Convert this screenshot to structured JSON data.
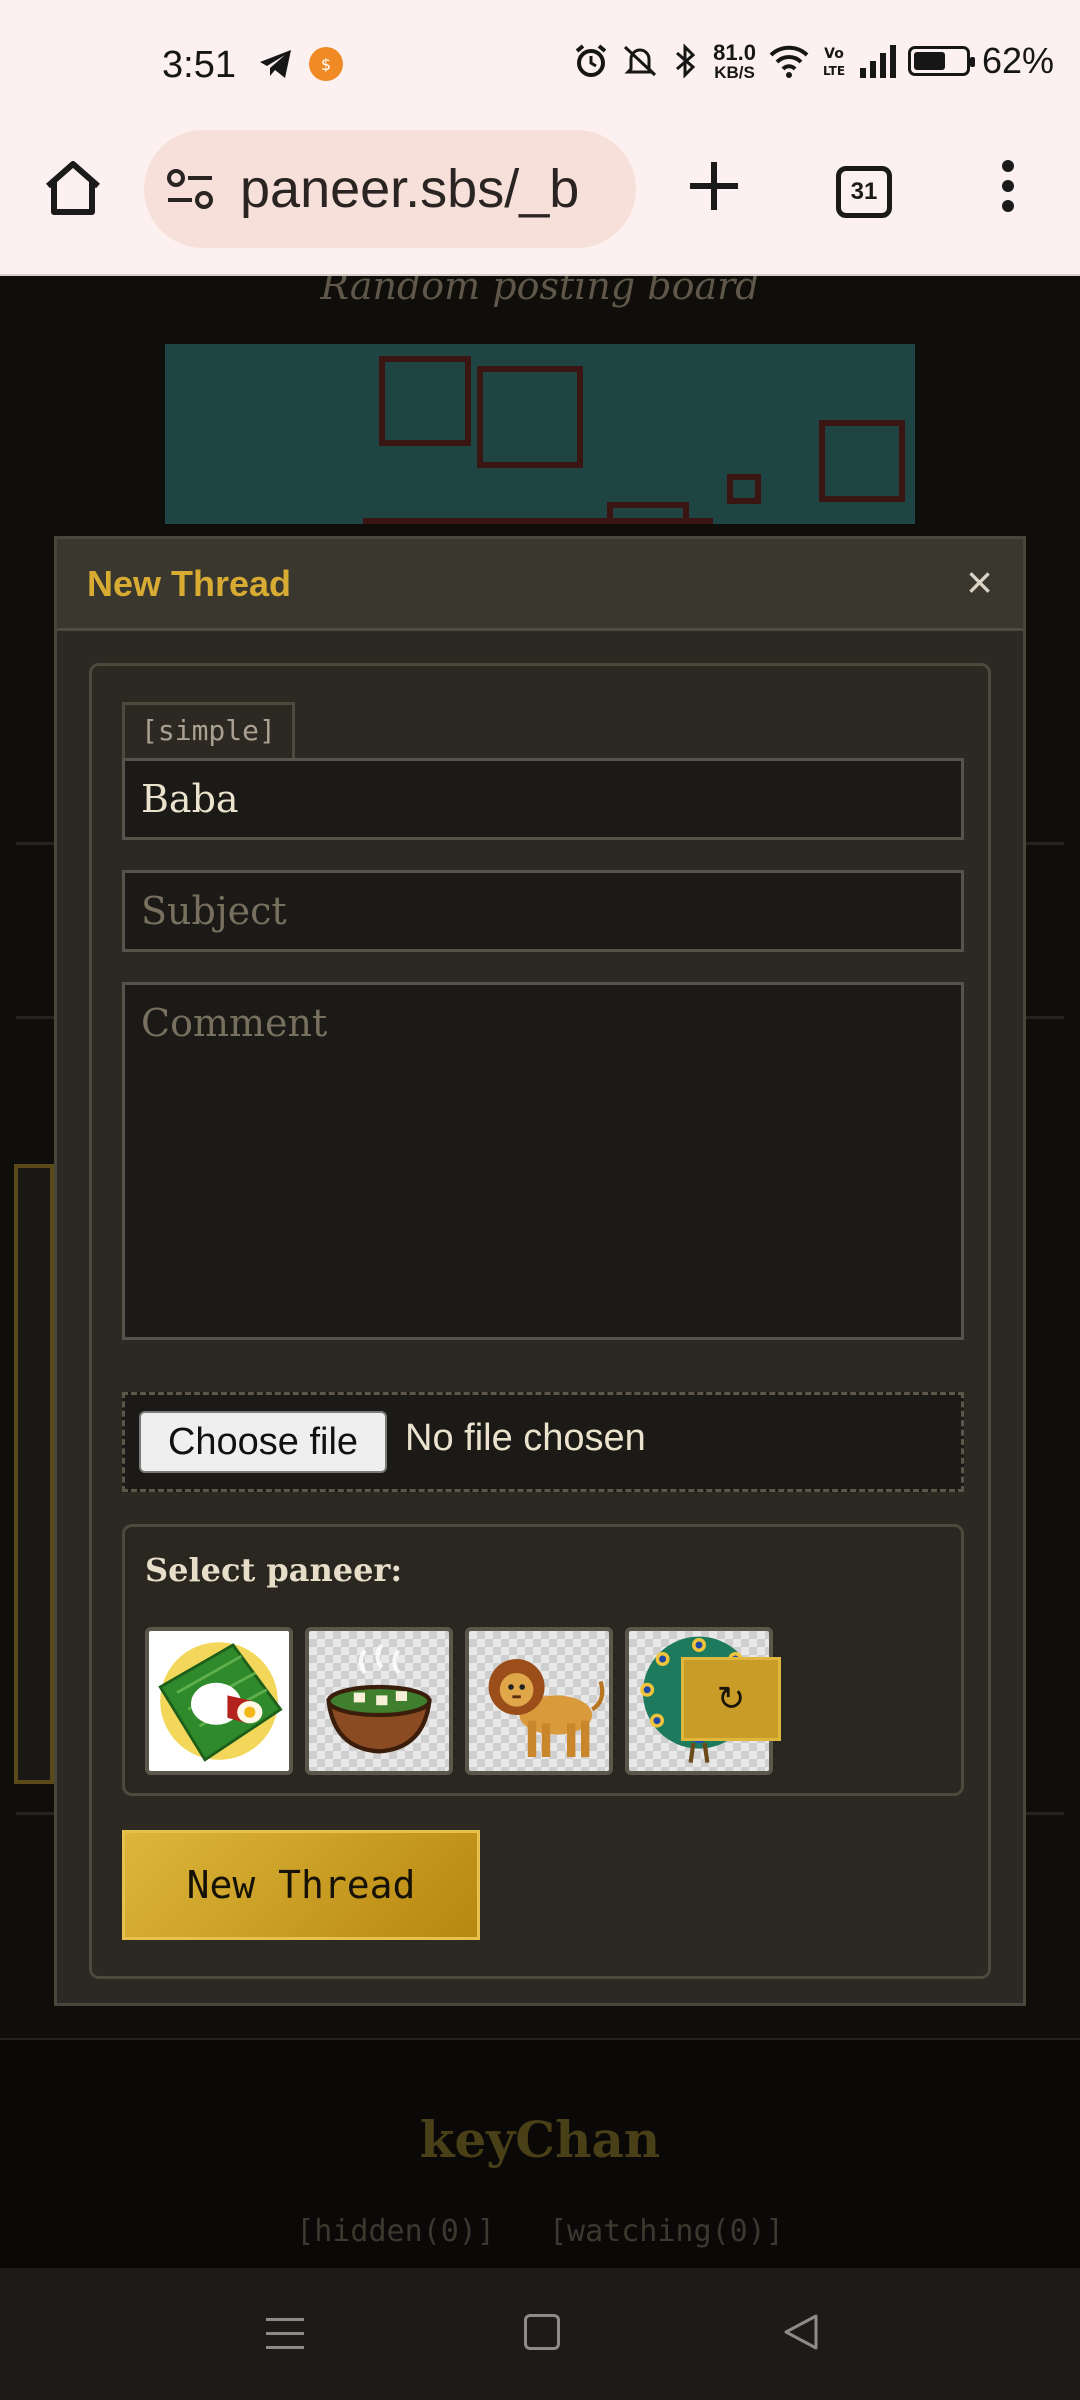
{
  "status_bar": {
    "time": "3:51",
    "network_speed_value": "81.0",
    "network_speed_unit": "KB/S",
    "battery_percent": "62%",
    "battery_level": 0.62,
    "icons": [
      "telegram-icon",
      "notification-app-icon",
      "alarm-icon",
      "mute-icon",
      "bluetooth-icon",
      "wifi-icon",
      "volte-icon",
      "signal-icon",
      "battery-icon"
    ]
  },
  "browser": {
    "url": "paneer.sbs/_b",
    "tab_count": "31"
  },
  "background_page": {
    "subtitle": "Random posting board",
    "footer_title": "keyChan",
    "footer_links": [
      "[hidden(0)]",
      "[watching(0)]"
    ]
  },
  "modal": {
    "title": "New Thread",
    "close_label": "×",
    "mode_tag": "[simple]",
    "name_value": "Baba",
    "subject_placeholder": "Subject",
    "comment_placeholder": "Comment",
    "file_button_label": "Choose file",
    "file_status": "No file chosen",
    "select_label": "Select paneer:",
    "paneer_options": [
      "banana-leaf-meal",
      "saag-paneer-bowl",
      "lion",
      "peacock"
    ],
    "refresh_label": "↻",
    "submit_label": "New Thread"
  },
  "colors": {
    "accent": "#d8ac33",
    "modal_bg": "#2c2922",
    "field_bg": "#1b1a16"
  }
}
